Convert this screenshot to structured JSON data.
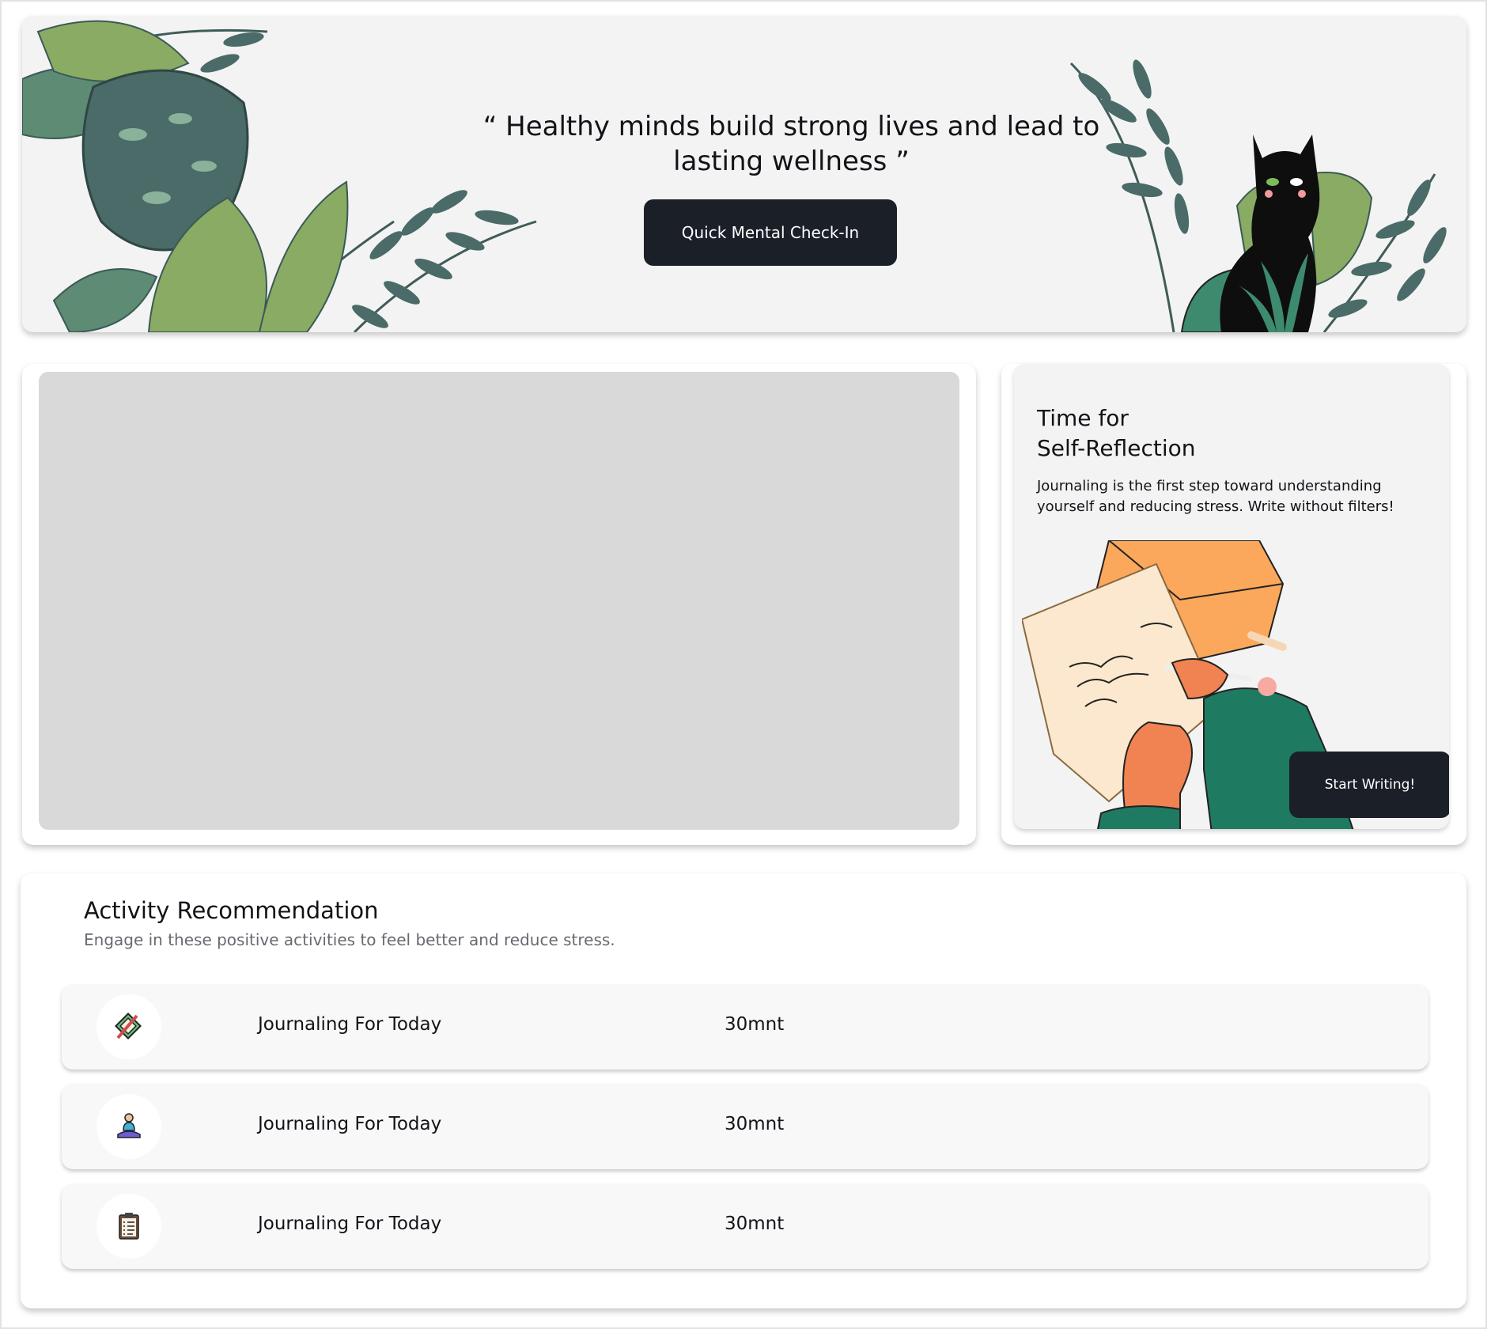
{
  "hero": {
    "quote": "“ Healthy minds build strong lives and lead to lasting wellness ”",
    "checkin_label": "Quick Mental Check-In"
  },
  "reflection": {
    "title_line1": "Time for",
    "title_line2": "Self-Reflection",
    "body": "Journaling is the first step toward understanding yourself and reducing stress. Write without filters!",
    "button_label": "Start Writing!"
  },
  "activities": {
    "title": "Activity Recommendation",
    "subtitle": "Engage in these positive activities to feel better and reduce stress.",
    "items": [
      {
        "icon": "notebook-pen-icon",
        "name": "Journaling For Today",
        "duration": "30mnt"
      },
      {
        "icon": "meditation-icon",
        "name": "Journaling For Today",
        "duration": "30mnt"
      },
      {
        "icon": "clipboard-checklist-icon",
        "name": "Journaling For Today",
        "duration": "30mnt"
      }
    ]
  },
  "colors": {
    "dark_button": "#1b1f28",
    "leaf_dark": "#4a6b68",
    "leaf_light": "#8aab63",
    "placeholder": "#d9d9d9"
  }
}
